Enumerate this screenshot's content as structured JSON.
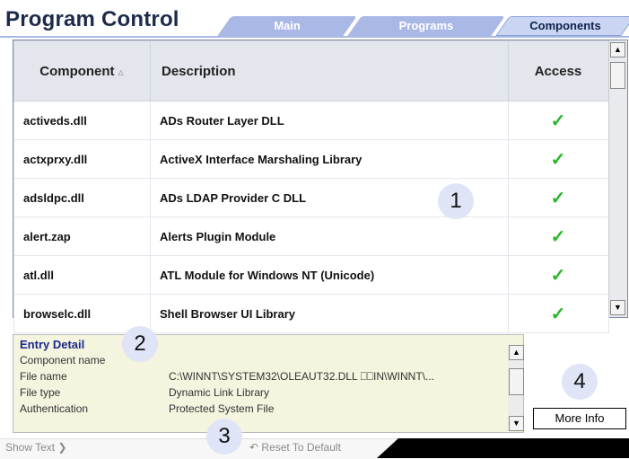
{
  "header": {
    "title": "Program Control"
  },
  "tabs": [
    {
      "label": "Main"
    },
    {
      "label": "Programs"
    },
    {
      "label": "Components",
      "active": true
    }
  ],
  "grid": {
    "columns": [
      "Component",
      "Description",
      "Access"
    ],
    "sort_icon": "sort-ascending-icon",
    "rows": [
      {
        "component": "activeds.dll",
        "description": "ADs Router Layer DLL",
        "access": "✓"
      },
      {
        "component": "actxprxy.dll",
        "description": "ActiveX Interface Marshaling Library",
        "access": "✓"
      },
      {
        "component": "adsldpc.dll",
        "description": "ADs LDAP Provider C DLL",
        "access": "✓"
      },
      {
        "component": "alert.zap",
        "description": "Alerts Plugin Module",
        "access": "✓"
      },
      {
        "component": "atl.dll",
        "description": "ATL Module for Windows NT (Unicode)",
        "access": "✓"
      },
      {
        "component": "browselc.dll",
        "description": "Shell Browser UI Library",
        "access": "✓"
      }
    ]
  },
  "callouts": [
    "1",
    "2",
    "3",
    "4"
  ],
  "detail": {
    "title": "Entry Detail",
    "labels": [
      "Component name",
      "File name",
      "File type",
      "Authentication"
    ],
    "values": [
      "",
      "C:\\WINNT\\SYSTEM32\\OLEAUT32.DLL ⎕⎕IN\\WINNT\\...",
      "Dynamic Link Library",
      "Protected System File"
    ]
  },
  "buttons": {
    "more_info": "More Info"
  },
  "footer": {
    "show_text": "Show Text",
    "reset": "Reset To Default"
  },
  "colors": {
    "tab": "#aab8e6",
    "check": "#2bb52b",
    "callout": "#dfe5f7"
  }
}
